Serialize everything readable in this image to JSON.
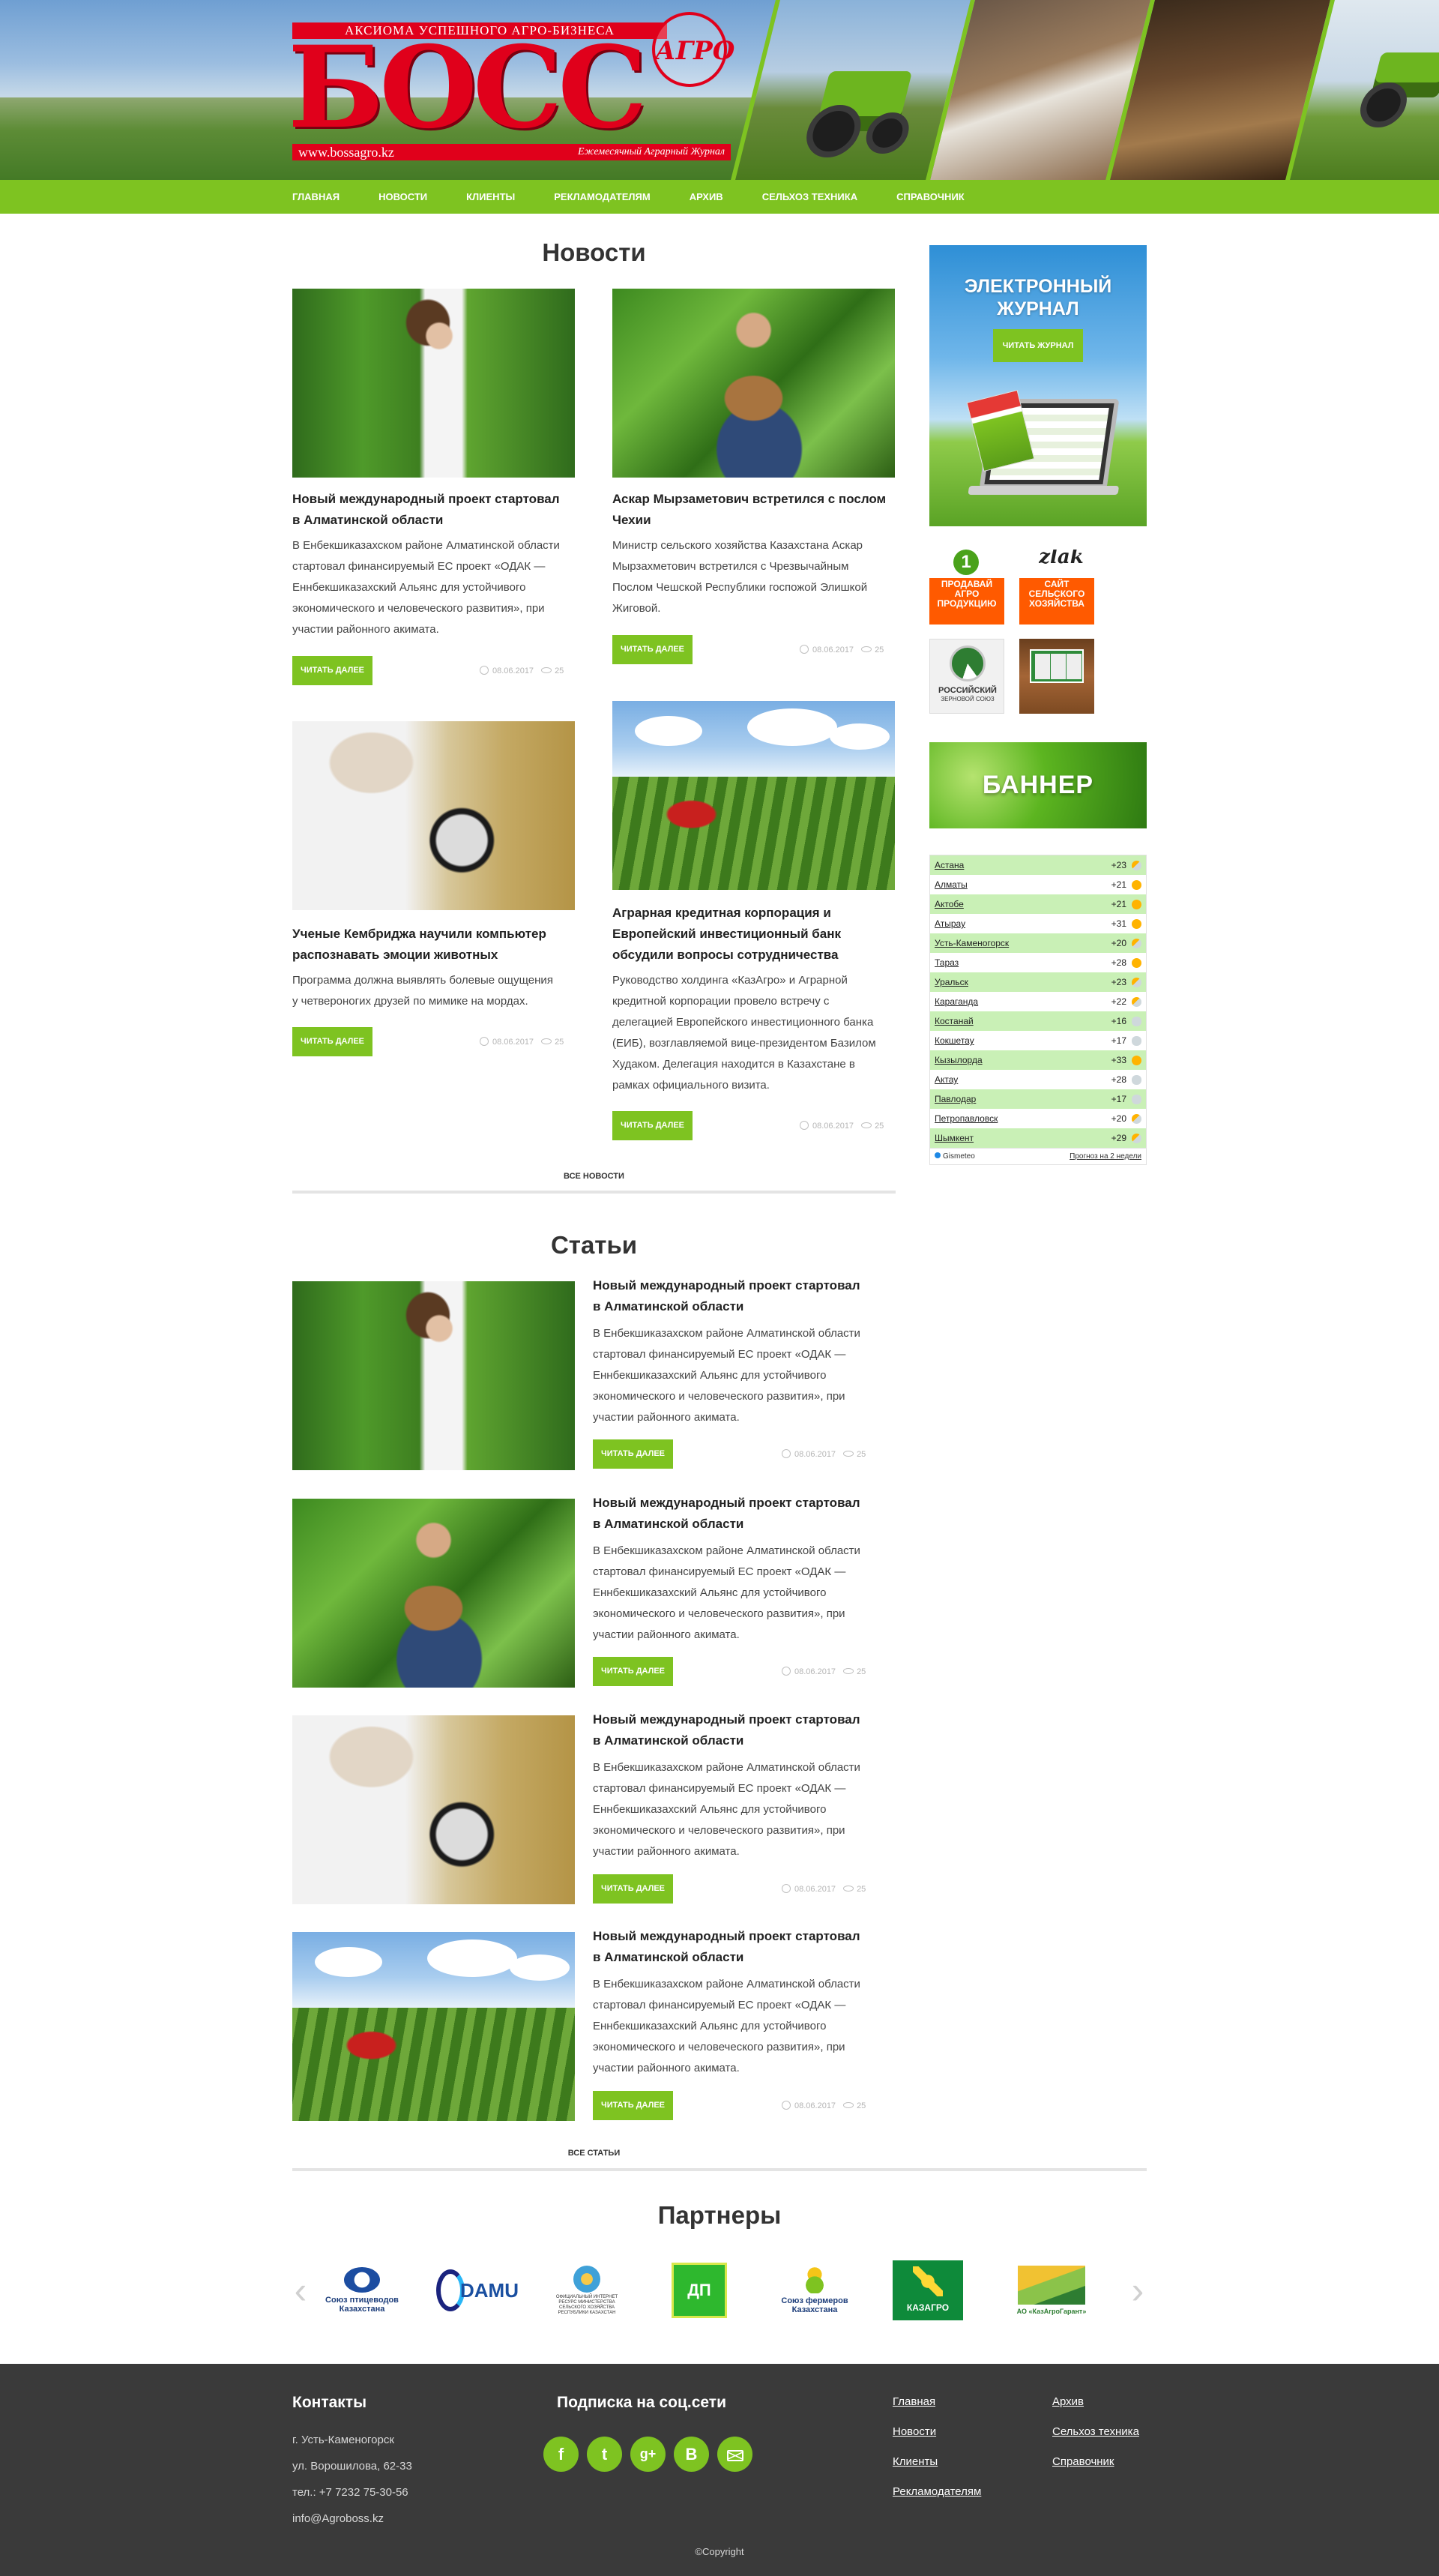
{
  "header": {
    "logo_tagline": "АКСИОМА УСПЕШНОГО АГРО-БИЗНЕСА",
    "logo_main": "БОСС",
    "logo_circle": "АГРО",
    "logo_url": "www.bossagro.kz",
    "logo_subtitle": "Ежемесячный Аграрный Журнал"
  },
  "nav": [
    "ГЛАВНАЯ",
    "НОВОСТИ",
    "КЛИЕНТЫ",
    "РЕКЛАМОДАТЕЛЯМ",
    "АРХИВ",
    "СЕЛЬХОЗ ТЕХНИКА",
    "СПРАВОЧНИК"
  ],
  "news": {
    "title": "Новости",
    "items": [
      {
        "image": "girl-greenhouse",
        "title_l1": "Новый международный проект стартовал",
        "title_l2": "в Алматинской области",
        "text": [
          "В Енбекшиказахском районе Алматинской области",
          "стартовал финансируемый ЕС проект «ОДАК —",
          "Еннбекшиказахский Альянс для устойчивого",
          "экономического и человеческого развития», при",
          "участии районного акимата."
        ],
        "button": "ЧИТАТЬ ДАЛЕЕ",
        "date": "08.06.2017",
        "views": "25"
      },
      {
        "image": "man-pepper",
        "title_l1": "Аскар Мырзаметович встретился с послом",
        "title_l2": "Чехии",
        "text": [
          "Министр сельского хозяйства Казахстана Аскар",
          "Мырзахметович встретился с Чрезвычайным",
          "Послом Чешской Республики госпожой Элишкой",
          "Жиговой."
        ],
        "button": "ЧИТАТЬ ДАЛЕЕ",
        "date": "08.06.2017",
        "views": "25"
      },
      {
        "image": "scientist-magnifier",
        "title_l1": "Ученые Кембриджа научили компьютер",
        "title_l2": "распознавать эмоции животных",
        "text": [
          "Программа должна выявлять болевые ощущения",
          "у четвероногих друзей по мимике на мордах."
        ],
        "button": "ЧИТАТЬ ДАЛЕЕ",
        "date": "08.06.2017",
        "views": "25"
      },
      {
        "image": "farmer-field",
        "title_l1": "Аграрная кредитная корпорация и",
        "title_l2": "Европейский инвестиционный банк",
        "title_l3": "обсудили вопросы сотрудничества",
        "text": [
          "Руководство холдинга «КазАгро» и Аграрной",
          "кредитной корпорации провело встречу с",
          "делегацией Европейского инвестиционного банка",
          "(ЕИБ), возглавляемой вице-президентом Базилом",
          "Худаком. Делегация находится в Казахстане в",
          "рамках официального визита."
        ],
        "button": "ЧИТАТЬ ДАЛЕЕ",
        "date": "08.06.2017",
        "views": "25"
      }
    ],
    "all_link": "ВСЕ НОВОСТИ"
  },
  "articles": {
    "title": "Статьи",
    "items": [
      {
        "image": "girl-greenhouse",
        "title_l1": "Новый международный проект стартовал",
        "title_l2": "в Алматинской области",
        "text": [
          "В Енбекшиказахском районе Алматинской области",
          "стартовал финансируемый ЕС проект «ОДАК —",
          "Еннбекшиказахский Альянс для устойчивого",
          "экономического и человеческого развития», при",
          "участии районного акимата."
        ],
        "button": "ЧИТАТЬ ДАЛЕЕ",
        "date": "08.06.2017",
        "views": "25"
      },
      {
        "image": "man-pepper",
        "title_l1": "Новый международный проект стартовал",
        "title_l2": "в Алматинской области",
        "text": [
          "В Енбекшиказахском районе Алматинской области",
          "стартовал финансируемый ЕС проект «ОДАК —",
          "Еннбекшиказахский Альянс для устойчивого",
          "экономического и человеческого развития», при",
          "участии районного акимата."
        ],
        "button": "ЧИТАТЬ ДАЛЕЕ",
        "date": "08.06.2017",
        "views": "25"
      },
      {
        "image": "scientist-magnifier",
        "title_l1": "Новый международный проект стартовал",
        "title_l2": "в Алматинской области",
        "text": [
          "В Енбекшиказахском районе Алматинской области",
          "стартовал финансируемый ЕС проект «ОДАК —",
          "Еннбекшиказахский Альянс для устойчивого",
          "экономического и человеческого развития», при",
          "участии районного акимата."
        ],
        "button": "ЧИТАТЬ ДАЛЕЕ",
        "date": "08.06.2017",
        "views": "25"
      },
      {
        "image": "farmer-field",
        "title_l1": "Новый международный проект стартовал",
        "title_l2": "в Алматинской области",
        "text": [
          "В Енбекшиказахском районе Алматинской области",
          "стартовал финансируемый ЕС проект «ОДАК —",
          "Еннбекшиказахский Альянс для устойчивого",
          "экономического и человеческого развития», при",
          "участии районного акимата."
        ],
        "button": "ЧИТАТЬ ДАЛЕЕ",
        "date": "08.06.2017",
        "views": "25"
      }
    ],
    "all_link": "ВСЕ СТАТЬИ"
  },
  "sidebar": {
    "magazine_title_l1": "ЭЛЕКТРОННЫЙ",
    "magazine_title_l2": "ЖУРНАЛ",
    "magazine_button": "ЧИТАТЬ ЖУРНАЛ",
    "tiles": {
      "sell_number": "1",
      "sell_label": "ПРОДАВАЙ АГРО ПРОДУКЦИЮ",
      "zlak_logo": "zlak",
      "zlak_label": "САЙТ СЕЛЬСКОГО ХОЗЯЙСТВА",
      "rzs_label": "РОССИЙСКИЙ",
      "rzs_sub": "ЗЕРНОВОЙ СОЮЗ"
    },
    "banner_label": "БАННЕР",
    "weather": {
      "rows": [
        {
          "city": "Астана",
          "temp": "+23",
          "icon": "partly-cloudy"
        },
        {
          "city": "Алматы",
          "temp": "+21",
          "icon": "sunny"
        },
        {
          "city": "Актобе",
          "temp": "+21",
          "icon": "sunny"
        },
        {
          "city": "Атырау",
          "temp": "+31",
          "icon": "sunny"
        },
        {
          "city": "Усть-Каменогорск",
          "temp": "+20",
          "icon": "partly-cloudy"
        },
        {
          "city": "Тараз",
          "temp": "+28",
          "icon": "sunny"
        },
        {
          "city": "Уральск",
          "temp": "+23",
          "icon": "partly-cloudy"
        },
        {
          "city": "Караганда",
          "temp": "+22",
          "icon": "partly-cloudy"
        },
        {
          "city": "Костанай",
          "temp": "+16",
          "icon": "cloudy"
        },
        {
          "city": "Кокшетау",
          "temp": "+17",
          "icon": "cloudy"
        },
        {
          "city": "Кызылорда",
          "temp": "+33",
          "icon": "sunny"
        },
        {
          "city": "Актау",
          "temp": "+28",
          "icon": "cloudy"
        },
        {
          "city": "Павлодар",
          "temp": "+17",
          "icon": "cloudy"
        },
        {
          "city": "Петропавловск",
          "temp": "+20",
          "icon": "partly-cloudy"
        },
        {
          "city": "Шымкент",
          "temp": "+29",
          "icon": "partly-cloudy"
        }
      ],
      "provider": "Gismeteo",
      "forecast_link": "Прогноз на 2 недели"
    }
  },
  "partners": {
    "title": "Партнеры",
    "items": [
      {
        "name": "Союз птицеводов Казахстана"
      },
      {
        "name": "DAMU"
      },
      {
        "name": "ОФИЦИАЛЬНЫЙ ИНТЕРНЕТ РЕСУРС МИНИСТЕРСТВА СЕЛЬСКОГО ХОЗЯЙСТВА РЕСПУБЛИКИ КАЗАХСТАН"
      },
      {
        "name": "ДП"
      },
      {
        "name": "Союз фермеров Казахстана"
      },
      {
        "name": "КАЗАГРО"
      },
      {
        "name": "АО «КазАгроГарант»"
      }
    ]
  },
  "footer": {
    "contacts_title": "Контакты",
    "city": "г. Усть-Каменогорск",
    "street": "ул. Ворошилова, 62-33",
    "phone": "тел.: +7 7232 75-30-56",
    "email": "info@Agroboss.kz",
    "social_title": "Подписка на соц.сети",
    "social": [
      "facebook-icon",
      "twitter-icon",
      "google-plus-icon",
      "blogger-icon",
      "mail-icon"
    ],
    "links_col1": [
      "Главная",
      "Новости",
      "Клиенты",
      "Рекламодателям"
    ],
    "links_col2": [
      "Архив",
      "Сельхоз техника",
      "Справочник"
    ],
    "copyright": "©Copyright"
  },
  "colors": {
    "accent": "#7ec321",
    "logo_red": "#e0001b",
    "footer_bg": "#3a3a3a"
  }
}
